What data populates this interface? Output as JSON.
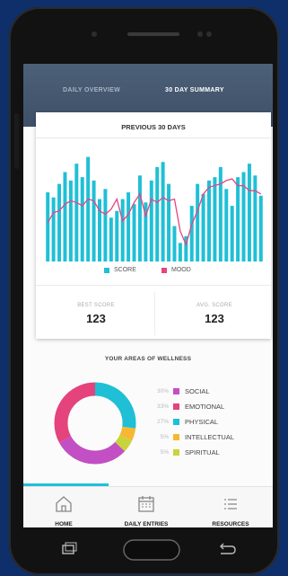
{
  "tabs": {
    "daily": "DAILY OVERVIEW",
    "summary": "30 DAY SUMMARY"
  },
  "card": {
    "title": "PREVIOUS 30 DAYS",
    "legend": {
      "score": "SCORE",
      "mood": "MOOD"
    },
    "best_label": "BEST SCORE",
    "best_value": "123",
    "avg_label": "AVG. SCORE",
    "avg_value": "123"
  },
  "chart_data": {
    "type": "bar",
    "series": [
      {
        "name": "SCORE",
        "color": "#1fc0d6",
        "values": [
          82,
          76,
          92,
          106,
          96,
          116,
          100,
          124,
          96,
          74,
          86,
          52,
          60,
          74,
          82,
          68,
          102,
          70,
          96,
          112,
          118,
          92,
          42,
          22,
          30,
          66,
          92,
          80,
          96,
          100,
          112,
          86,
          66,
          100,
          106,
          116,
          102,
          78
        ]
      },
      {
        "name": "MOOD",
        "color": "#e8437f",
        "values": [
          46,
          58,
          60,
          68,
          72,
          70,
          66,
          74,
          72,
          60,
          56,
          62,
          74,
          48,
          56,
          70,
          80,
          54,
          74,
          70,
          76,
          72,
          74,
          36,
          20,
          44,
          60,
          80,
          88,
          90,
          92,
          96,
          98,
          90,
          90,
          84,
          84,
          80
        ]
      }
    ]
  },
  "areas": {
    "title": "YOUR AREAS OF WELLNESS",
    "items": [
      {
        "pct": "30%",
        "label": "SOCIAL",
        "color": "#c24fc3",
        "value": 30
      },
      {
        "pct": "33%",
        "label": "EMOTIONAL",
        "color": "#e4437c",
        "value": 33
      },
      {
        "pct": "27%",
        "label": "PHYSICAL",
        "color": "#1fbfd5",
        "value": 27
      },
      {
        "pct": "5%",
        "label": "INTELLECTUAL",
        "color": "#f7b733",
        "value": 5
      },
      {
        "pct": "5%",
        "label": "SPIRITUAL",
        "color": "#c9d43a",
        "value": 5
      }
    ]
  },
  "nav": [
    {
      "label": "HOME",
      "icon": "home-icon"
    },
    {
      "label": "DAILY ENTRIES",
      "icon": "calendar-icon"
    },
    {
      "label": "RESOURCES",
      "icon": "list-icon"
    }
  ],
  "progress": 0.34
}
